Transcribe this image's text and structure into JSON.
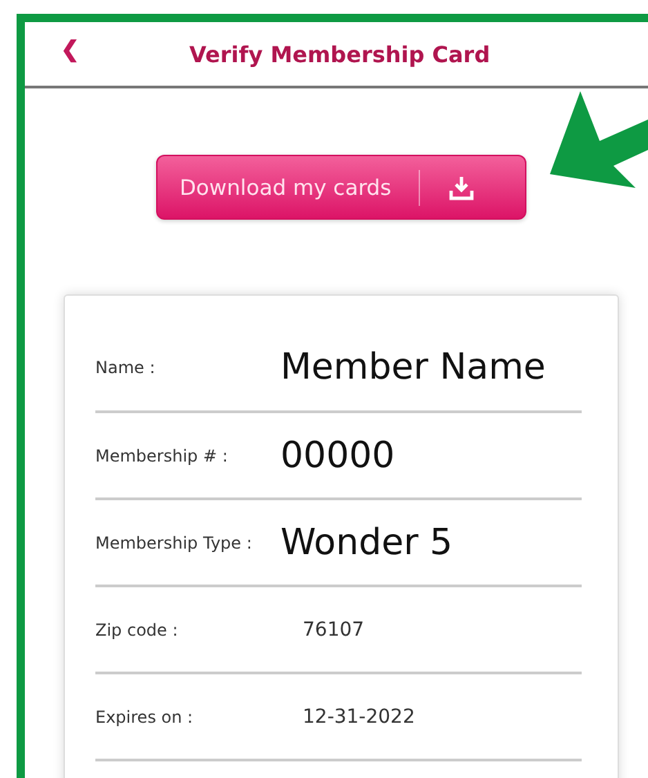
{
  "header": {
    "back_glyph": "❮",
    "title": "Verify Membership Card"
  },
  "download_button": {
    "label": "Download my cards"
  },
  "card": {
    "rows": [
      {
        "label": "Name :",
        "value": "Member Name",
        "kind": "overlay"
      },
      {
        "label": "Membership # :",
        "value": "00000",
        "kind": "overlay"
      },
      {
        "label": "Membership Type :",
        "value": "Wonder 5",
        "kind": "overlay"
      },
      {
        "label": "Zip code :",
        "value": "76107",
        "kind": "plain"
      },
      {
        "label": "Expires on :",
        "value": "12-31-2022",
        "kind": "plain"
      }
    ]
  }
}
